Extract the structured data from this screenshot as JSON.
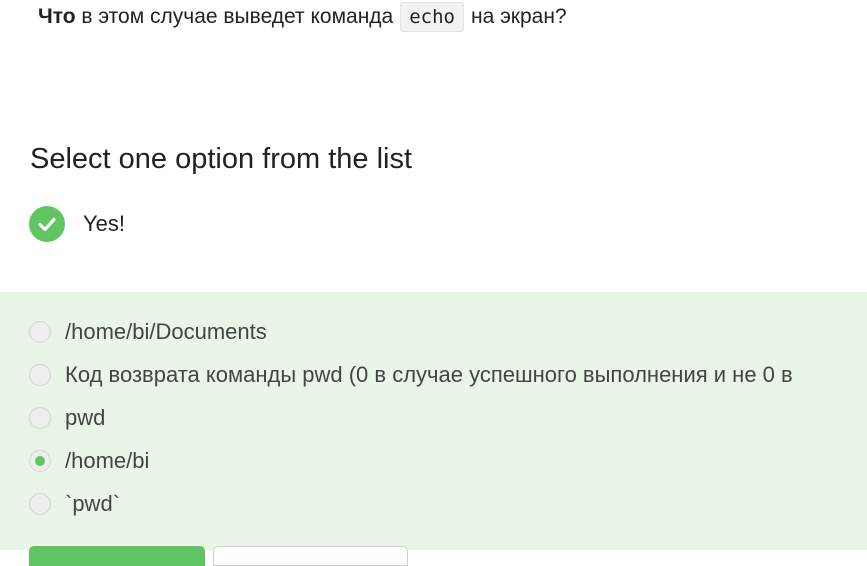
{
  "question": {
    "bold_word": "Что",
    "text_before_code": " в этом случае выведет команда",
    "code": "echo",
    "text_after_code": "на экран?"
  },
  "section_title": "Select one option from the list",
  "result": {
    "status_icon": "check-circle-icon",
    "text": "Yes!",
    "color": "#5fc462"
  },
  "options": [
    {
      "label": "/home/bi/Documents",
      "selected": false
    },
    {
      "label": "Код возврата команды pwd (0 в случае успешного выполнения и не 0 в",
      "selected": false
    },
    {
      "label": "pwd",
      "selected": false
    },
    {
      "label": "/home/bi",
      "selected": true
    },
    {
      "label": "`pwd`",
      "selected": false
    }
  ],
  "colors": {
    "accent": "#5fc462",
    "panel_background": "#e9f6e7"
  }
}
